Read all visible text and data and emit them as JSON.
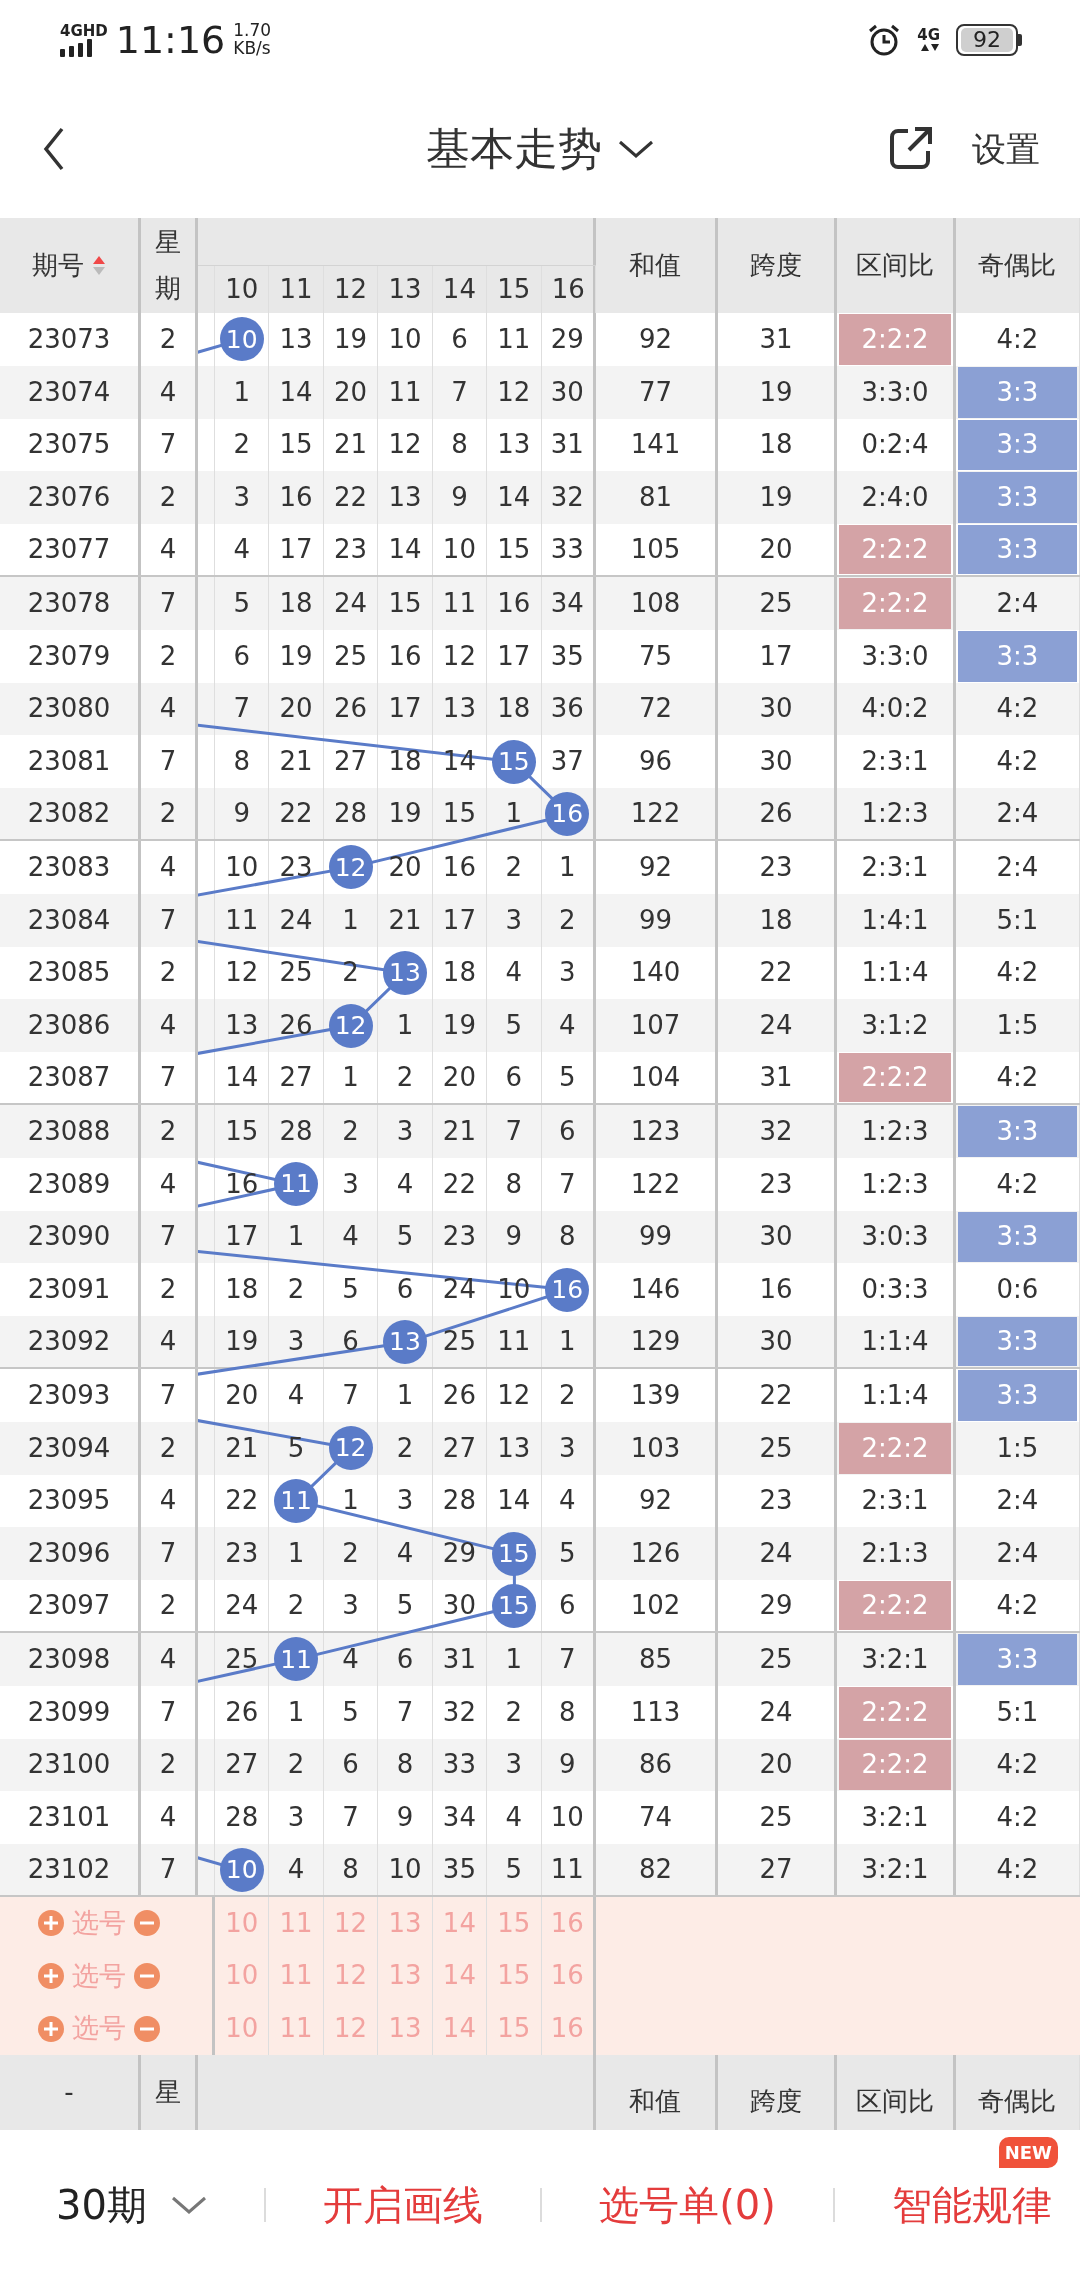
{
  "status_bar": {
    "network": "4GHD",
    "time": "11:16",
    "speed_value": "1.70",
    "speed_unit": "KB/s",
    "mobile": "4G",
    "battery": "92"
  },
  "header": {
    "title": "基本走势",
    "settings": "设置"
  },
  "columns": {
    "issue": "期号",
    "sort_ascending": true,
    "weekday": "星期",
    "numbers": [
      "10",
      "11",
      "12",
      "13",
      "14",
      "15",
      "16"
    ],
    "sum": "和值",
    "span": "跨度",
    "zone": "区间比",
    "parity": "奇偶比"
  },
  "rows": [
    {
      "issue": "23073",
      "weekday": "2",
      "cells": [
        "10",
        "13",
        "19",
        "10",
        "6",
        "11",
        "29"
      ],
      "balls": [
        true,
        false,
        false,
        false,
        false,
        false,
        false
      ],
      "sum": "92",
      "span": "31",
      "zone": "2:2:2",
      "zone_hot": true,
      "parity": "4:2",
      "parity_hot": false
    },
    {
      "issue": "23074",
      "weekday": "4",
      "cells": [
        "1",
        "14",
        "20",
        "11",
        "7",
        "12",
        "30"
      ],
      "balls": [
        false,
        false,
        false,
        false,
        false,
        false,
        false
      ],
      "sum": "77",
      "span": "19",
      "zone": "3:3:0",
      "zone_hot": false,
      "parity": "3:3",
      "parity_hot": true
    },
    {
      "issue": "23075",
      "weekday": "7",
      "cells": [
        "2",
        "15",
        "21",
        "12",
        "8",
        "13",
        "31"
      ],
      "balls": [
        false,
        false,
        false,
        false,
        false,
        false,
        false
      ],
      "sum": "141",
      "span": "18",
      "zone": "0:2:4",
      "zone_hot": false,
      "parity": "3:3",
      "parity_hot": true
    },
    {
      "issue": "23076",
      "weekday": "2",
      "cells": [
        "3",
        "16",
        "22",
        "13",
        "9",
        "14",
        "32"
      ],
      "balls": [
        false,
        false,
        false,
        false,
        false,
        false,
        false
      ],
      "sum": "81",
      "span": "19",
      "zone": "2:4:0",
      "zone_hot": false,
      "parity": "3:3",
      "parity_hot": true
    },
    {
      "issue": "23077",
      "weekday": "4",
      "cells": [
        "4",
        "17",
        "23",
        "14",
        "10",
        "15",
        "33"
      ],
      "balls": [
        false,
        false,
        false,
        false,
        false,
        false,
        false
      ],
      "sum": "105",
      "span": "20",
      "zone": "2:2:2",
      "zone_hot": true,
      "parity": "3:3",
      "parity_hot": true
    },
    {
      "issue": "23078",
      "weekday": "7",
      "cells": [
        "5",
        "18",
        "24",
        "15",
        "11",
        "16",
        "34"
      ],
      "balls": [
        false,
        false,
        false,
        false,
        false,
        false,
        false
      ],
      "sum": "108",
      "span": "25",
      "zone": "2:2:2",
      "zone_hot": true,
      "parity": "2:4",
      "parity_hot": false
    },
    {
      "issue": "23079",
      "weekday": "2",
      "cells": [
        "6",
        "19",
        "25",
        "16",
        "12",
        "17",
        "35"
      ],
      "balls": [
        false,
        false,
        false,
        false,
        false,
        false,
        false
      ],
      "sum": "75",
      "span": "17",
      "zone": "3:3:0",
      "zone_hot": false,
      "parity": "3:3",
      "parity_hot": true
    },
    {
      "issue": "23080",
      "weekday": "4",
      "cells": [
        "7",
        "20",
        "26",
        "17",
        "13",
        "18",
        "36"
      ],
      "balls": [
        false,
        false,
        false,
        false,
        false,
        false,
        false
      ],
      "sum": "72",
      "span": "30",
      "zone": "4:0:2",
      "zone_hot": false,
      "parity": "4:2",
      "parity_hot": false
    },
    {
      "issue": "23081",
      "weekday": "7",
      "cells": [
        "8",
        "21",
        "27",
        "18",
        "14",
        "15",
        "37"
      ],
      "balls": [
        false,
        false,
        false,
        false,
        false,
        true,
        false
      ],
      "sum": "96",
      "span": "30",
      "zone": "2:3:1",
      "zone_hot": false,
      "parity": "4:2",
      "parity_hot": false
    },
    {
      "issue": "23082",
      "weekday": "2",
      "cells": [
        "9",
        "22",
        "28",
        "19",
        "15",
        "1",
        "16"
      ],
      "balls": [
        false,
        false,
        false,
        false,
        false,
        false,
        true
      ],
      "sum": "122",
      "span": "26",
      "zone": "1:2:3",
      "zone_hot": false,
      "parity": "2:4",
      "parity_hot": false
    },
    {
      "issue": "23083",
      "weekday": "4",
      "cells": [
        "10",
        "23",
        "12",
        "20",
        "16",
        "2",
        "1"
      ],
      "balls": [
        false,
        false,
        true,
        false,
        false,
        false,
        false
      ],
      "sum": "92",
      "span": "23",
      "zone": "2:3:1",
      "zone_hot": false,
      "parity": "2:4",
      "parity_hot": false
    },
    {
      "issue": "23084",
      "weekday": "7",
      "cells": [
        "11",
        "24",
        "1",
        "21",
        "17",
        "3",
        "2"
      ],
      "balls": [
        false,
        false,
        false,
        false,
        false,
        false,
        false
      ],
      "sum": "99",
      "span": "18",
      "zone": "1:4:1",
      "zone_hot": false,
      "parity": "5:1",
      "parity_hot": false
    },
    {
      "issue": "23085",
      "weekday": "2",
      "cells": [
        "12",
        "25",
        "2",
        "13",
        "18",
        "4",
        "3"
      ],
      "balls": [
        false,
        false,
        false,
        true,
        false,
        false,
        false
      ],
      "sum": "140",
      "span": "22",
      "zone": "1:1:4",
      "zone_hot": false,
      "parity": "4:2",
      "parity_hot": false
    },
    {
      "issue": "23086",
      "weekday": "4",
      "cells": [
        "13",
        "26",
        "12",
        "1",
        "19",
        "5",
        "4"
      ],
      "balls": [
        false,
        false,
        true,
        false,
        false,
        false,
        false
      ],
      "sum": "107",
      "span": "24",
      "zone": "3:1:2",
      "zone_hot": false,
      "parity": "1:5",
      "parity_hot": false
    },
    {
      "issue": "23087",
      "weekday": "7",
      "cells": [
        "14",
        "27",
        "1",
        "2",
        "20",
        "6",
        "5"
      ],
      "balls": [
        false,
        false,
        false,
        false,
        false,
        false,
        false
      ],
      "sum": "104",
      "span": "31",
      "zone": "2:2:2",
      "zone_hot": true,
      "parity": "4:2",
      "parity_hot": false
    },
    {
      "issue": "23088",
      "weekday": "2",
      "cells": [
        "15",
        "28",
        "2",
        "3",
        "21",
        "7",
        "6"
      ],
      "balls": [
        false,
        false,
        false,
        false,
        false,
        false,
        false
      ],
      "sum": "123",
      "span": "32",
      "zone": "1:2:3",
      "zone_hot": false,
      "parity": "3:3",
      "parity_hot": true
    },
    {
      "issue": "23089",
      "weekday": "4",
      "cells": [
        "16",
        "11",
        "3",
        "4",
        "22",
        "8",
        "7"
      ],
      "balls": [
        false,
        true,
        false,
        false,
        false,
        false,
        false
      ],
      "sum": "122",
      "span": "23",
      "zone": "1:2:3",
      "zone_hot": false,
      "parity": "4:2",
      "parity_hot": false
    },
    {
      "issue": "23090",
      "weekday": "7",
      "cells": [
        "17",
        "1",
        "4",
        "5",
        "23",
        "9",
        "8"
      ],
      "balls": [
        false,
        false,
        false,
        false,
        false,
        false,
        false
      ],
      "sum": "99",
      "span": "30",
      "zone": "3:0:3",
      "zone_hot": false,
      "parity": "3:3",
      "parity_hot": true
    },
    {
      "issue": "23091",
      "weekday": "2",
      "cells": [
        "18",
        "2",
        "5",
        "6",
        "24",
        "10",
        "16"
      ],
      "balls": [
        false,
        false,
        false,
        false,
        false,
        false,
        true
      ],
      "sum": "146",
      "span": "16",
      "zone": "0:3:3",
      "zone_hot": false,
      "parity": "0:6",
      "parity_hot": false
    },
    {
      "issue": "23092",
      "weekday": "4",
      "cells": [
        "19",
        "3",
        "6",
        "13",
        "25",
        "11",
        "1"
      ],
      "balls": [
        false,
        false,
        false,
        true,
        false,
        false,
        false
      ],
      "sum": "129",
      "span": "30",
      "zone": "1:1:4",
      "zone_hot": false,
      "parity": "3:3",
      "parity_hot": true
    },
    {
      "issue": "23093",
      "weekday": "7",
      "cells": [
        "20",
        "4",
        "7",
        "1",
        "26",
        "12",
        "2"
      ],
      "balls": [
        false,
        false,
        false,
        false,
        false,
        false,
        false
      ],
      "sum": "139",
      "span": "22",
      "zone": "1:1:4",
      "zone_hot": false,
      "parity": "3:3",
      "parity_hot": true
    },
    {
      "issue": "23094",
      "weekday": "2",
      "cells": [
        "21",
        "5",
        "12",
        "2",
        "27",
        "13",
        "3"
      ],
      "balls": [
        false,
        false,
        true,
        false,
        false,
        false,
        false
      ],
      "sum": "103",
      "span": "25",
      "zone": "2:2:2",
      "zone_hot": true,
      "parity": "1:5",
      "parity_hot": false
    },
    {
      "issue": "23095",
      "weekday": "4",
      "cells": [
        "22",
        "11",
        "1",
        "3",
        "28",
        "14",
        "4"
      ],
      "balls": [
        false,
        true,
        false,
        false,
        false,
        false,
        false
      ],
      "sum": "92",
      "span": "23",
      "zone": "2:3:1",
      "zone_hot": false,
      "parity": "2:4",
      "parity_hot": false
    },
    {
      "issue": "23096",
      "weekday": "7",
      "cells": [
        "23",
        "1",
        "2",
        "4",
        "29",
        "15",
        "5"
      ],
      "balls": [
        false,
        false,
        false,
        false,
        false,
        true,
        false
      ],
      "sum": "126",
      "span": "24",
      "zone": "2:1:3",
      "zone_hot": false,
      "parity": "2:4",
      "parity_hot": false
    },
    {
      "issue": "23097",
      "weekday": "2",
      "cells": [
        "24",
        "2",
        "3",
        "5",
        "30",
        "15",
        "6"
      ],
      "balls": [
        false,
        false,
        false,
        false,
        false,
        true,
        false
      ],
      "sum": "102",
      "span": "29",
      "zone": "2:2:2",
      "zone_hot": true,
      "parity": "4:2",
      "parity_hot": false
    },
    {
      "issue": "23098",
      "weekday": "4",
      "cells": [
        "25",
        "11",
        "4",
        "6",
        "31",
        "1",
        "7"
      ],
      "balls": [
        false,
        true,
        false,
        false,
        false,
        false,
        false
      ],
      "sum": "85",
      "span": "25",
      "zone": "3:2:1",
      "zone_hot": false,
      "parity": "3:3",
      "parity_hot": true
    },
    {
      "issue": "23099",
      "weekday": "7",
      "cells": [
        "26",
        "1",
        "5",
        "7",
        "32",
        "2",
        "8"
      ],
      "balls": [
        false,
        false,
        false,
        false,
        false,
        false,
        false
      ],
      "sum": "113",
      "span": "24",
      "zone": "2:2:2",
      "zone_hot": true,
      "parity": "5:1",
      "parity_hot": false
    },
    {
      "issue": "23100",
      "weekday": "2",
      "cells": [
        "27",
        "2",
        "6",
        "8",
        "33",
        "3",
        "9"
      ],
      "balls": [
        false,
        false,
        false,
        false,
        false,
        false,
        false
      ],
      "sum": "86",
      "span": "20",
      "zone": "2:2:2",
      "zone_hot": true,
      "parity": "4:2",
      "parity_hot": false
    },
    {
      "issue": "23101",
      "weekday": "4",
      "cells": [
        "28",
        "3",
        "7",
        "9",
        "34",
        "4",
        "10"
      ],
      "balls": [
        false,
        false,
        false,
        false,
        false,
        false,
        false
      ],
      "sum": "74",
      "span": "25",
      "zone": "3:2:1",
      "zone_hot": false,
      "parity": "4:2",
      "parity_hot": false
    },
    {
      "issue": "23102",
      "weekday": "7",
      "cells": [
        "10",
        "4",
        "8",
        "10",
        "35",
        "5",
        "11"
      ],
      "balls": [
        true,
        false,
        false,
        false,
        false,
        false,
        false
      ],
      "sum": "82",
      "span": "27",
      "zone": "3:2:1",
      "zone_hot": false,
      "parity": "4:2",
      "parity_hot": false
    }
  ],
  "pick_rows": [
    {
      "label": "选号",
      "numbers": [
        "10",
        "11",
        "12",
        "13",
        "14",
        "15",
        "16"
      ]
    },
    {
      "label": "选号",
      "numbers": [
        "10",
        "11",
        "12",
        "13",
        "14",
        "15",
        "16"
      ]
    },
    {
      "label": "选号",
      "numbers": [
        "10",
        "11",
        "12",
        "13",
        "14",
        "15",
        "16"
      ]
    }
  ],
  "footer_columns": {
    "issue": "-",
    "weekday": "星",
    "sum": "和值",
    "span": "跨度",
    "zone": "区间比",
    "parity": "奇偶比"
  },
  "bottom_bar": {
    "period": "30期",
    "actions": [
      {
        "label": "开启画线"
      },
      {
        "label": "选号单(0)"
      },
      {
        "label": "智能规律",
        "badge": "NEW"
      }
    ]
  }
}
